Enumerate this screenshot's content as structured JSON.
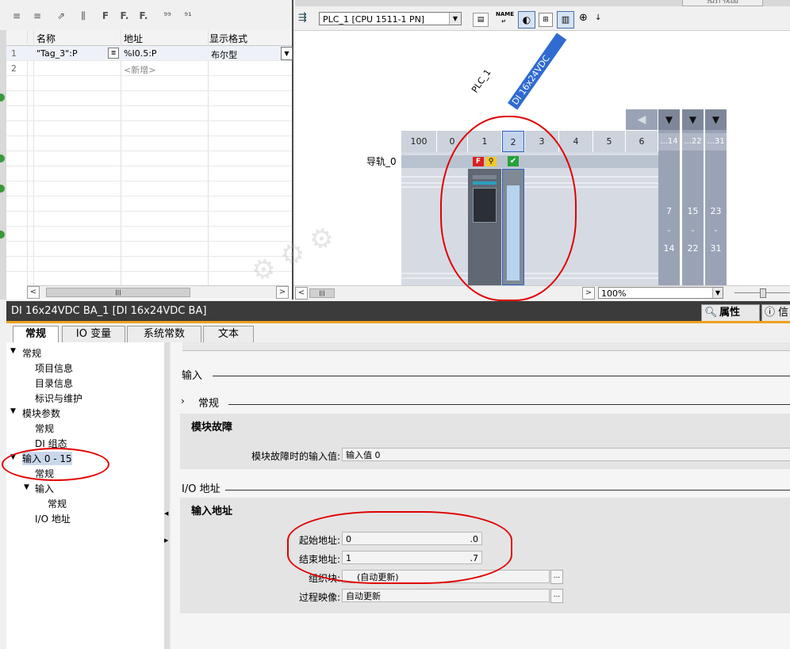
{
  "tag_table": {
    "headers": {
      "name": "名称",
      "address": "地址",
      "format": "显示格式"
    },
    "rows": [
      {
        "num": "1",
        "name": "\"Tag_3\":P",
        "address": "%I0.5:P",
        "format": "布尔型"
      },
      {
        "num": "2",
        "name": "",
        "address": "<新增>",
        "format": ""
      }
    ],
    "toolbar_icons": [
      "add-tag-icon",
      "insert-row-icon",
      "remove-icon",
      "monitor-icon",
      "force-icon",
      "force-f-icon",
      "force-f-icon-2",
      "show-values-icon",
      "modify-icon"
    ]
  },
  "device_view": {
    "device_select": "PLC_1 [CPU 1511-1 PN]",
    "zoom": "100%",
    "rail_label": "导轨_0",
    "plc_label": "PLC_1",
    "module_label": "DI 16x24VDC BA_1",
    "slots": [
      "100",
      "0",
      "1",
      "2",
      "3",
      "4",
      "5",
      "6",
      "...14",
      "...22",
      "...31"
    ],
    "expansions": [
      {
        "top": "7",
        "mid": "-",
        "bottom": "14"
      },
      {
        "top": "15",
        "mid": "-",
        "bottom": "22"
      },
      {
        "top": "23",
        "mid": "-",
        "bottom": "31"
      }
    ],
    "tabs_partial": [
      "拓扑视图"
    ]
  },
  "properties": {
    "title": "DI 16x24VDC BA_1 [DI 16x24VDC BA]",
    "right_tabs": [
      "属性",
      "信"
    ],
    "tabs": [
      "常规",
      "IO 变量",
      "系统常数",
      "文本"
    ],
    "nav": [
      {
        "label": "常规",
        "level": 0,
        "arrow": "▼"
      },
      {
        "label": "项目信息",
        "level": 1
      },
      {
        "label": "目录信息",
        "level": 1
      },
      {
        "label": "标识与维护",
        "level": 1
      },
      {
        "label": "模块参数",
        "level": 0,
        "arrow": "▼"
      },
      {
        "label": "常规",
        "level": 1
      },
      {
        "label": "DI 组态",
        "level": 1
      },
      {
        "label": "输入 0 - 15",
        "level": 0,
        "arrow": "▼"
      },
      {
        "label": "常规",
        "level": 1
      },
      {
        "label": "输入",
        "level": 1,
        "arrow": "▼"
      },
      {
        "label": "常规",
        "level": 2
      },
      {
        "label": "I/O 地址",
        "level": 1
      }
    ],
    "content": {
      "section_input": "输入",
      "section_general": "常规",
      "group_fault": "模块故障",
      "fault_label": "模块故障时的输入值:",
      "fault_value": "输入值 0",
      "section_io": "I/O 地址",
      "group_input_addr": "输入地址",
      "start_label": "起始地址:",
      "start_value": "0",
      "start_suffix": ".0",
      "end_label": "结束地址:",
      "end_value": "1",
      "end_suffix": ".7",
      "ob_label": "组织块:",
      "ob_value": "(自动更新)",
      "pi_label": "过程映像:",
      "pi_value": "自动更新"
    }
  }
}
